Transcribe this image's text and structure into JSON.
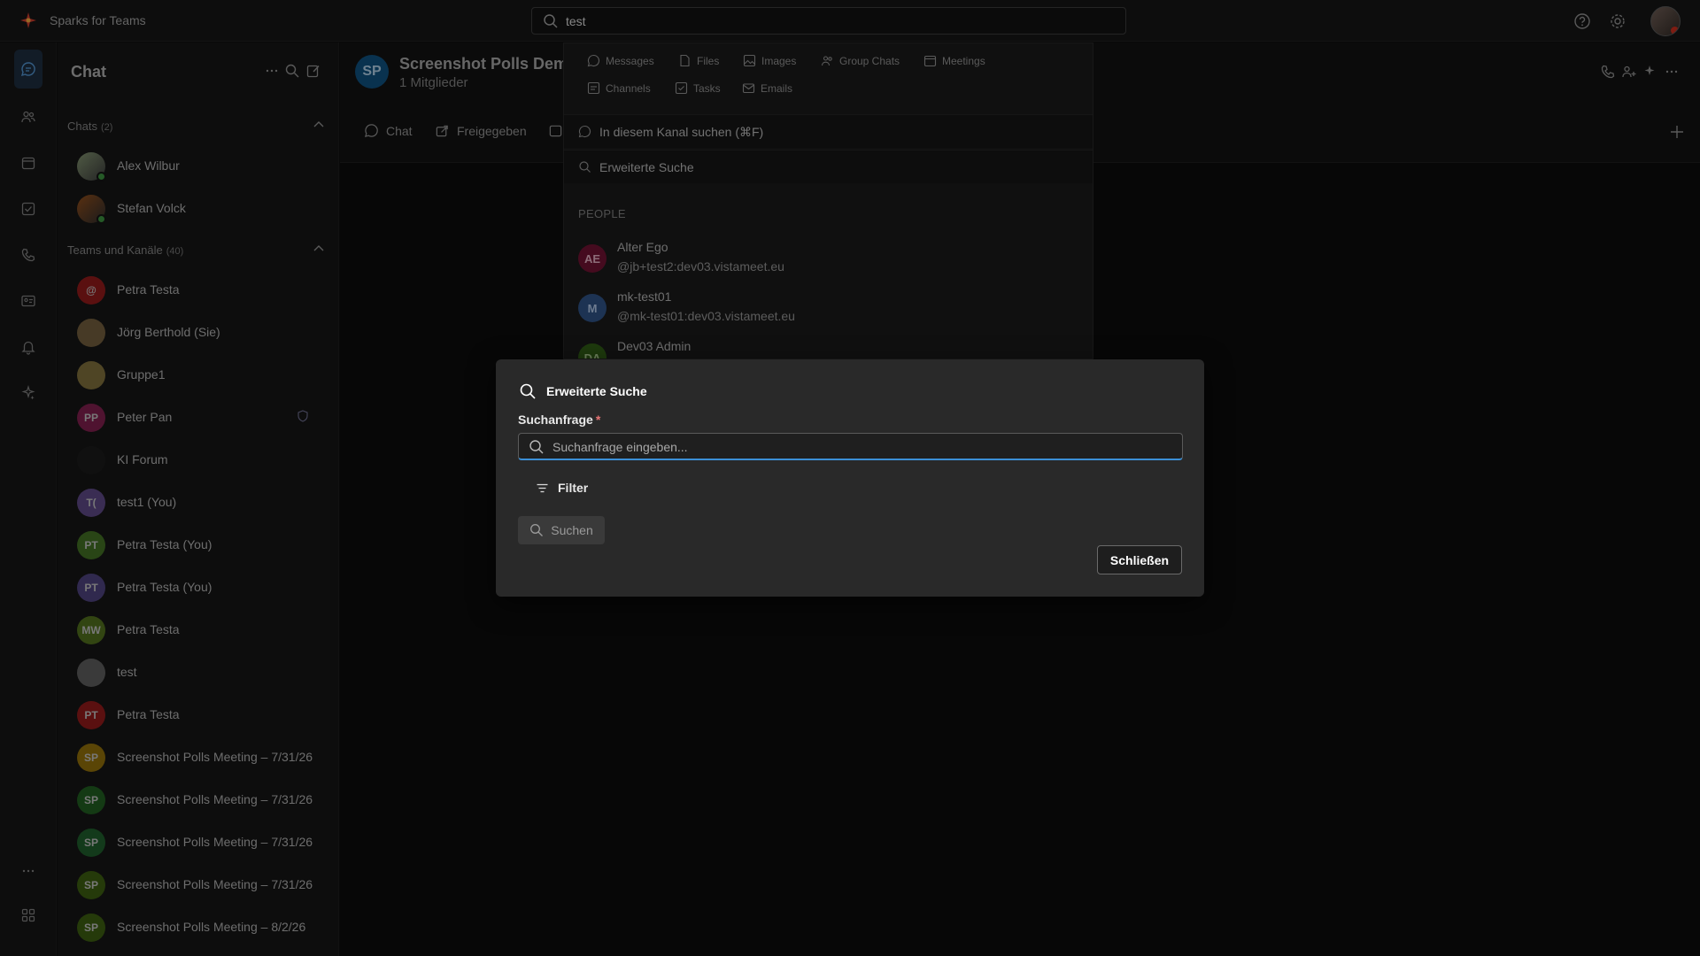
{
  "app": {
    "name": "Sparks for Teams"
  },
  "search": {
    "query": "test"
  },
  "chat_panel": {
    "title": "Chat",
    "chats_section": {
      "label": "Chats",
      "count": "(2)"
    },
    "chats": [
      {
        "name": "Alex Wilbur"
      },
      {
        "name": "Stefan Volck"
      }
    ],
    "teams_section": {
      "label": "Teams und Kanäle",
      "count": "(40)"
    },
    "teams": [
      {
        "name": "Petra Testa",
        "initials": "@",
        "color": "#8a1a1a"
      },
      {
        "name": "Jörg Berthold (Sie)",
        "initials": "",
        "color": "#6d5a3b"
      },
      {
        "name": "Gruppe1",
        "initials": "",
        "color": "#7a6a3a"
      },
      {
        "name": "Peter Pan",
        "initials": "PP",
        "color": "#7a1e4a"
      },
      {
        "name": "KI Forum",
        "initials": "",
        "color": "#1a1a1a"
      },
      {
        "name": "test1 (You)",
        "initials": "T(",
        "color": "#5a4680"
      },
      {
        "name": "Petra Testa (You)",
        "initials": "PT",
        "color": "#3f6b22"
      },
      {
        "name": "Petra Testa (You)",
        "initials": "PT",
        "color": "#4b3f78"
      },
      {
        "name": "Petra Testa",
        "initials": "MW",
        "color": "#4e6b1c"
      },
      {
        "name": "test",
        "initials": "",
        "color": "#5a5a5a"
      },
      {
        "name": "Petra Testa",
        "initials": "PT",
        "color": "#8a1a1a"
      },
      {
        "name": "Screenshot Polls Meeting – 7/31/26",
        "initials": "SP",
        "color": "#8a6a0a"
      },
      {
        "name": "Screenshot Polls Meeting – 7/31/26",
        "initials": "SP",
        "color": "#1f5a1f"
      },
      {
        "name": "Screenshot Polls Meeting – 7/31/26",
        "initials": "SP",
        "color": "#1e5a2a"
      },
      {
        "name": "Screenshot Polls Meeting – 7/31/26",
        "initials": "SP",
        "color": "#3a5a10"
      },
      {
        "name": "Screenshot Polls Meeting – 8/2/26",
        "initials": "SP",
        "color": "#3a5a10"
      }
    ]
  },
  "main": {
    "team_initials": "SP",
    "team_title": "Screenshot Polls Demo",
    "members": "1 Mitglieder",
    "tabs": {
      "chat": "Chat",
      "shared": "Freigegeben"
    }
  },
  "dropdown": {
    "scopes": {
      "messages": "Messages",
      "files": "Files",
      "images": "Images",
      "group_chats": "Group Chats",
      "meetings": "Meetings",
      "channels": "Channels",
      "tasks": "Tasks",
      "emails": "Emails"
    },
    "channel_search": "In diesem Kanal suchen (⌘F)",
    "advanced_search": "Erweiterte Suche",
    "people_header": "PEOPLE",
    "people": [
      {
        "initials": "AE",
        "name": "Alter Ego",
        "handle": "@jb+test2:dev03.vistameet.eu",
        "color": "#6b1230",
        "fg": "#d9a7b8"
      },
      {
        "initials": "M",
        "name": "mk-test01",
        "handle": "@mk-test01:dev03.vistameet.eu",
        "color": "#2d4f80",
        "fg": "#a9bfdd"
      },
      {
        "initials": "DA",
        "name": "Dev03 Admin",
        "handle": "",
        "color": "#2f5a14",
        "fg": "#a6c48a"
      }
    ]
  },
  "modal": {
    "title": "Erweiterte Suche",
    "label": "Suchanfrage",
    "required_mark": "*",
    "placeholder": "Suchanfrage eingeben...",
    "filter": "Filter",
    "search_button": "Suchen",
    "close_button": "Schließen"
  }
}
